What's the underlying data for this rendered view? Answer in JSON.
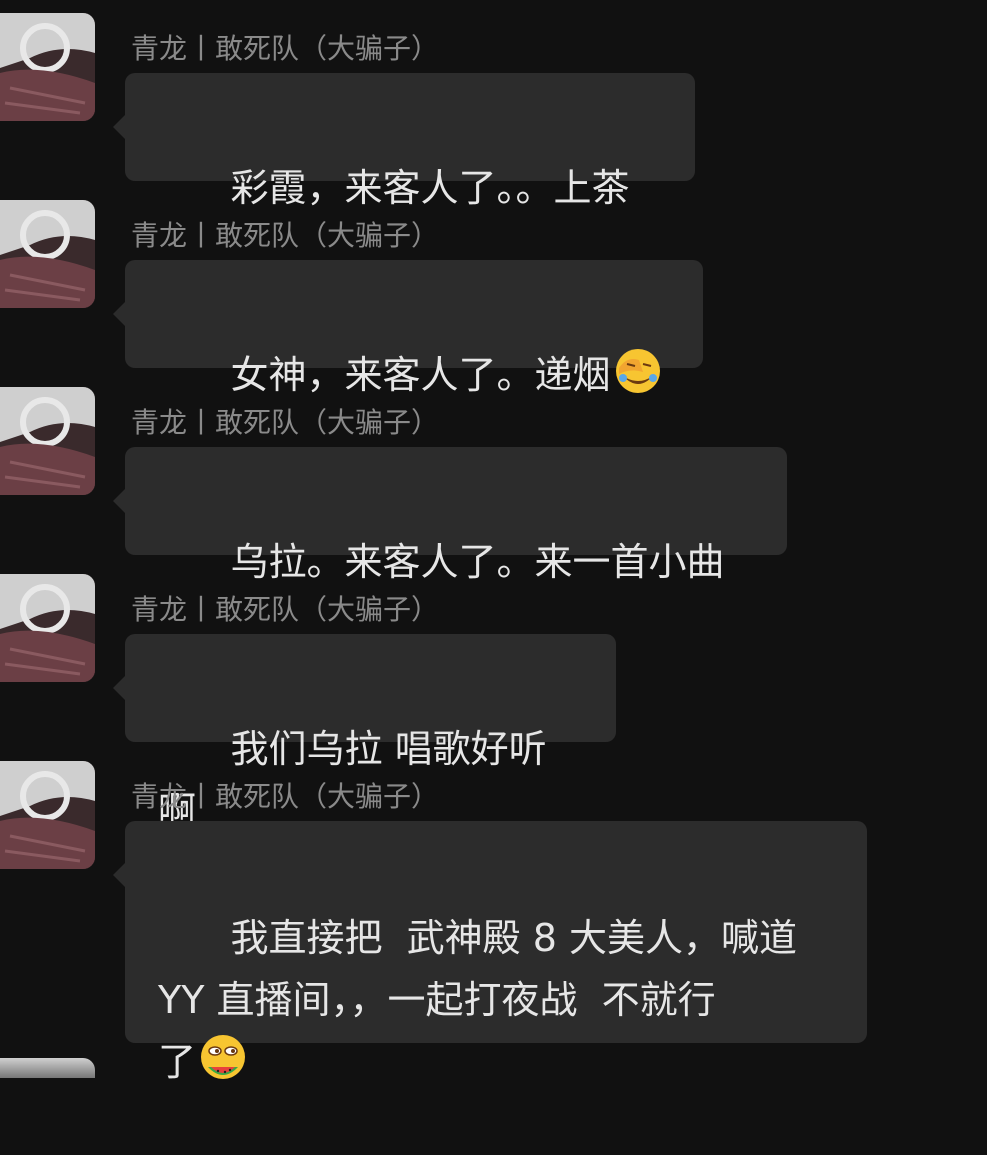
{
  "colors": {
    "background": "#111111",
    "bubble": "#2c2c2c",
    "sender_text": "#8a8a8a",
    "message_text": "#e6e6e6"
  },
  "messages": [
    {
      "avatar_icon": "avatar-car-interior",
      "sender": "青龙丨敢死队（大骗子）",
      "text": "彩霞，来客人了。。上茶",
      "emoji": null
    },
    {
      "avatar_icon": "avatar-car-interior",
      "sender": "青龙丨敢死队（大骗子）",
      "text": "女神，来客人了。递烟",
      "emoji": "facepalm-laugh-emoji"
    },
    {
      "avatar_icon": "avatar-car-interior",
      "sender": "青龙丨敢死队（大骗子）",
      "text": "乌拉。来客人了。来一首小曲",
      "emoji": null
    },
    {
      "avatar_icon": "avatar-car-interior",
      "sender": "青龙丨敢死队（大骗子）",
      "text": "我们乌拉 唱歌好听啊",
      "emoji": null
    },
    {
      "avatar_icon": "avatar-car-interior",
      "sender": "青龙丨敢死队（大骗子）",
      "text": "我直接把  武神殿 8 大美人，喊道\nYY 直播间，，一起打夜战  不就行\n了",
      "emoji": "watermelon-eating-emoji"
    }
  ]
}
